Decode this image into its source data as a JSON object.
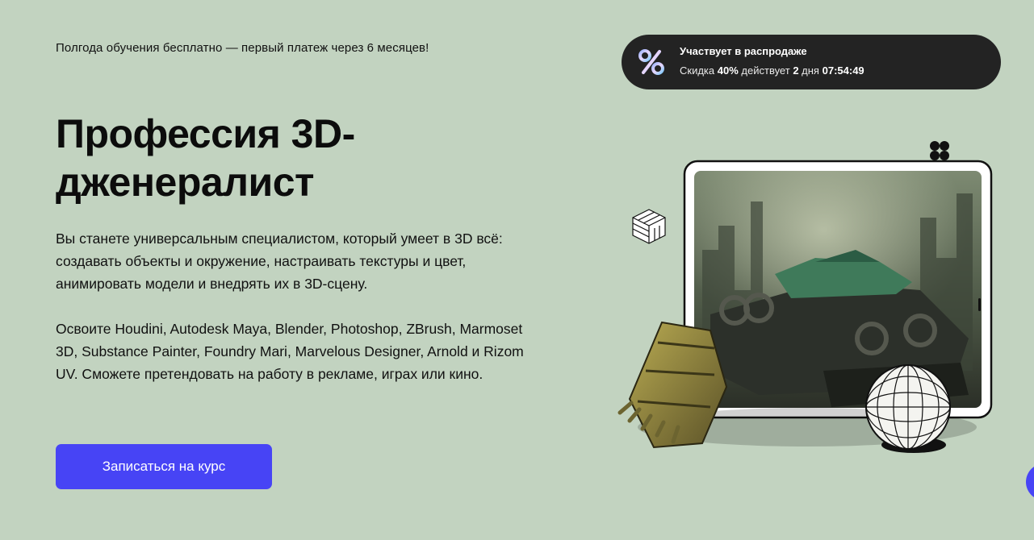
{
  "promo": {
    "text": "Полгода обучения бесплатно — первый платеж через 6 месяцев!"
  },
  "sale": {
    "icon": "percent-icon",
    "title": "Участвует в распродаже",
    "discount_prefix": "Скидка",
    "discount_value": "40%",
    "valid_text": "действует",
    "days_value": "2",
    "days_unit": "дня",
    "timer": "07:54:49"
  },
  "hero": {
    "title": "Профессия 3D-дженералист",
    "description_1": "Вы станете универсальным специалистом, который умеет в 3D всё: создавать объекты и окружение, настраивать текстуры и цвет, анимировать модели и внедрять их в 3D-сцену.",
    "description_2": "Освоите Houdini, Autodesk Maya, Blender, Photoshop, ZBrush, Marmoset 3D, Substance Painter, Foundry Mari, Marvelous Designer, Arnold и Rizom UV. Сможете претендовать на работу в рекламе, играх или кино.",
    "cta_label": "Записаться на курс"
  },
  "colors": {
    "background": "#c2d3c0",
    "pill": "#232323",
    "accent": "#4744f5"
  }
}
